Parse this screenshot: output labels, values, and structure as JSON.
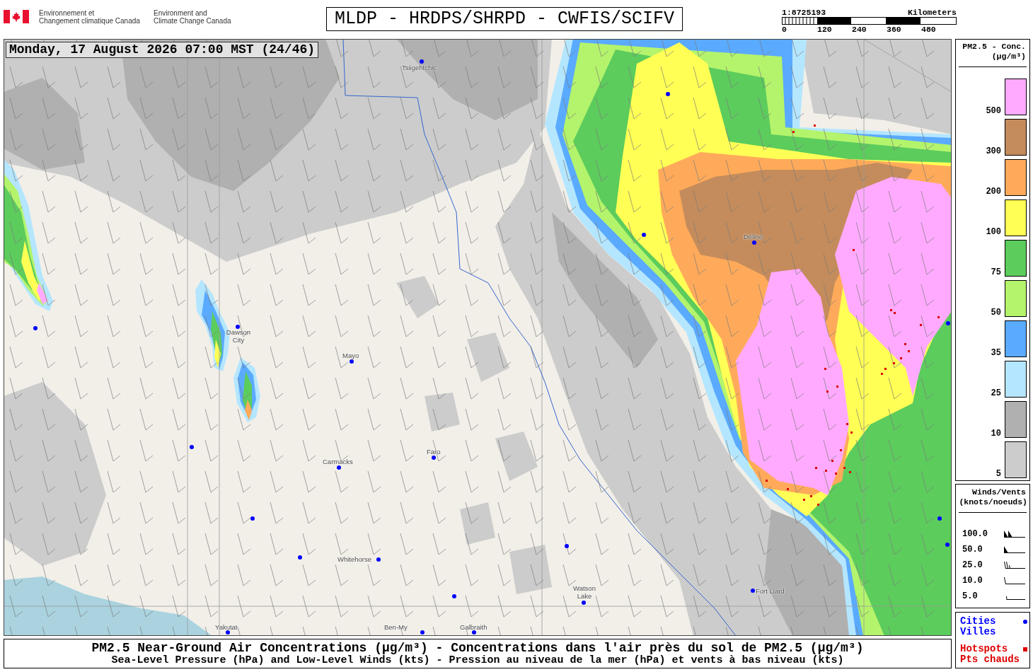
{
  "header": {
    "agency_fr": "Environnement et\nChangement climatique Canada",
    "agency_en": "Environment and\nClimate Change Canada",
    "title": "MLDP - HRDPS/SHRPD - CWFIS/SCIFV",
    "scale": {
      "ratio": "1:8725193",
      "unit": "Kilometers",
      "ticks": [
        "0",
        "120",
        "240",
        "360",
        "480"
      ]
    }
  },
  "map": {
    "timestamp": "Monday, 17 August 2026 07:00 MST (24/46)",
    "cities": [
      "Tsiigehtchic",
      "Dawson City",
      "Mayo",
      "Carmacks",
      "Faro",
      "Whitehorse",
      "Watson Lake",
      "Déline",
      "Fort Liard",
      "Yakutat",
      "Ben-My",
      "Galbraith"
    ]
  },
  "concentration_legend": {
    "title": "PM2.5 - Conc.",
    "unit": "(µg/m³)",
    "bins": [
      {
        "label": "500",
        "color": "#ffaaff"
      },
      {
        "label": "300",
        "color": "#c48c5c"
      },
      {
        "label": "200",
        "color": "#ffaa5a"
      },
      {
        "label": "100",
        "color": "#ffff55"
      },
      {
        "label": "75",
        "color": "#5ccc5c"
      },
      {
        "label": "50",
        "color": "#b4f46c"
      },
      {
        "label": "35",
        "color": "#5aaaff"
      },
      {
        "label": "25",
        "color": "#b4e6ff"
      },
      {
        "label": "10",
        "color": "#b0b0b0"
      },
      {
        "label": "5",
        "color": "#cccccc"
      }
    ]
  },
  "wind_legend": {
    "title": "Winds/Vents",
    "unit": "(knots/noeuds)",
    "rows": [
      {
        "speed": "100.0",
        "kind": "pennants"
      },
      {
        "speed": "50.0",
        "kind": "pennant"
      },
      {
        "speed": "25.0",
        "kind": "barbs"
      },
      {
        "speed": "10.0",
        "kind": "barb"
      },
      {
        "speed": "5.0",
        "kind": "halfbarb"
      }
    ]
  },
  "marker_legend": [
    {
      "label": "Cities\nVilles",
      "kind": "dot",
      "color": "#0000ff"
    },
    {
      "label": "Hotspots\nPts chauds",
      "kind": "square",
      "color": "#dd0000"
    }
  ],
  "caption": {
    "title": "PM2.5 Near-Ground Air Concentrations (µg/m³) - Concentrations dans l'air près du sol de PM2.5 (µg/m³)",
    "subtitle": "Sea-Level Pressure (hPa) and Low-Level Winds (kts) - Pression au niveau de la mer (hPa) et vents à bas niveau (kts)"
  }
}
